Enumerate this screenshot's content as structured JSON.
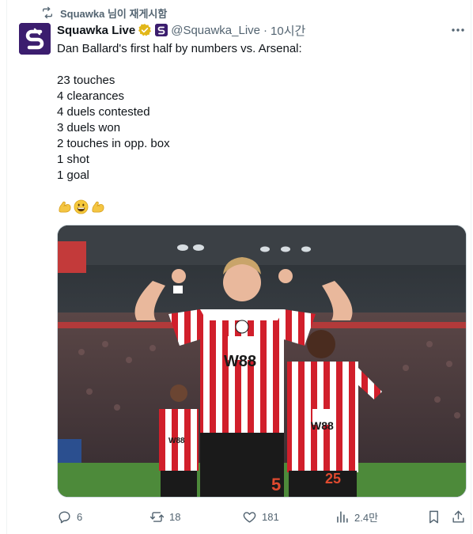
{
  "repost": {
    "label": "Squawka 님이 재게시함",
    "icon": "repost-icon"
  },
  "tweet": {
    "author_name": "Squawka Live",
    "handle": "@Squawka_Live",
    "separator": "·",
    "time": "10시간",
    "lines": [
      "Dan Ballard's first half by numbers vs. Arsenal:",
      "",
      "23 touches",
      "4 clearances",
      "4 duels contested",
      "3 duels won",
      "2 touches in opp. box",
      "1 shot",
      "1 goal"
    ],
    "emojis": [
      "flexed-biceps",
      "grinning-face",
      "flexed-biceps"
    ]
  },
  "media": {
    "description_icon": "photo",
    "shirt_sponsor": "W88",
    "player_numbers": [
      "5",
      "25"
    ]
  },
  "actions": {
    "replies": "6",
    "reposts": "18",
    "likes": "181",
    "views": "2.4만"
  },
  "colors": {
    "text": "#0f1419",
    "muted": "#536471",
    "brand": "#3b1d6e",
    "verified_gold": "#e2b719",
    "shirt_red": "#d11f2b"
  }
}
